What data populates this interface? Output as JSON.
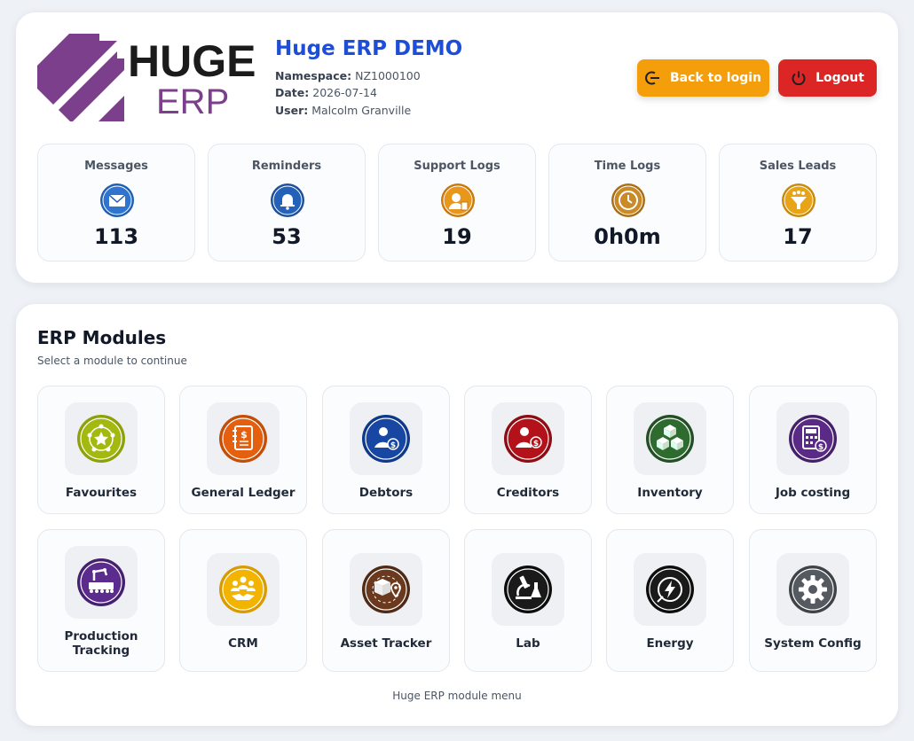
{
  "header": {
    "logo": {
      "word1": "HUGE",
      "word2": "ERP"
    },
    "title": "Huge ERP DEMO",
    "namespace_label": "Namespace:",
    "namespace_value": "NZ1000100",
    "date_label": "Date:",
    "date_value": "2026-07-14",
    "user_label": "User:",
    "user_value": "Malcolm Granville",
    "back_button": "Back to login",
    "logout_button": "Logout"
  },
  "stats": [
    {
      "label": "Messages",
      "value": "113",
      "icon": "envelope-icon",
      "color": "#1e5fb4"
    },
    {
      "label": "Reminders",
      "value": "53",
      "icon": "bell-icon",
      "color": "#1d4f9a"
    },
    {
      "label": "Support Logs",
      "value": "19",
      "icon": "support-agent-icon",
      "color": "#e8961c"
    },
    {
      "label": "Time Logs",
      "value": "0h0m",
      "icon": "clock-icon",
      "color": "#c98a27"
    },
    {
      "label": "Sales Leads",
      "value": "17",
      "icon": "funnel-icon",
      "color": "#e8a317"
    }
  ],
  "modules_section": {
    "title": "ERP Modules",
    "subtitle": "Select a module to continue",
    "footer": "Huge ERP module menu"
  },
  "modules": [
    {
      "label": "Favourites",
      "icon": "star-network-icon",
      "color": "#a4b90f"
    },
    {
      "label": "General Ledger",
      "icon": "ledger-book-icon",
      "color": "#e5600e"
    },
    {
      "label": "Debtors",
      "icon": "user-dollar-icon",
      "color": "#1846a3"
    },
    {
      "label": "Creditors",
      "icon": "user-dollar-out-icon",
      "color": "#b3121b"
    },
    {
      "label": "Inventory",
      "icon": "boxes-icon",
      "color": "#2e6b2f"
    },
    {
      "label": "Job costing",
      "icon": "calculator-icon",
      "color": "#5b2a86"
    },
    {
      "label": "Production Tracking",
      "icon": "robot-arm-icon",
      "color": "#5c2b8e"
    },
    {
      "label": "CRM",
      "icon": "handshake-icon",
      "color": "#f2b400"
    },
    {
      "label": "Asset Tracker",
      "icon": "package-location-icon",
      "color": "#6b3a1e"
    },
    {
      "label": "Lab",
      "icon": "microscope-icon",
      "color": "#1a1a1a"
    },
    {
      "label": "Energy",
      "icon": "lightning-icon",
      "color": "#1a1a1a"
    },
    {
      "label": "System Config",
      "icon": "gear-icon",
      "color": "#555a60"
    }
  ]
}
